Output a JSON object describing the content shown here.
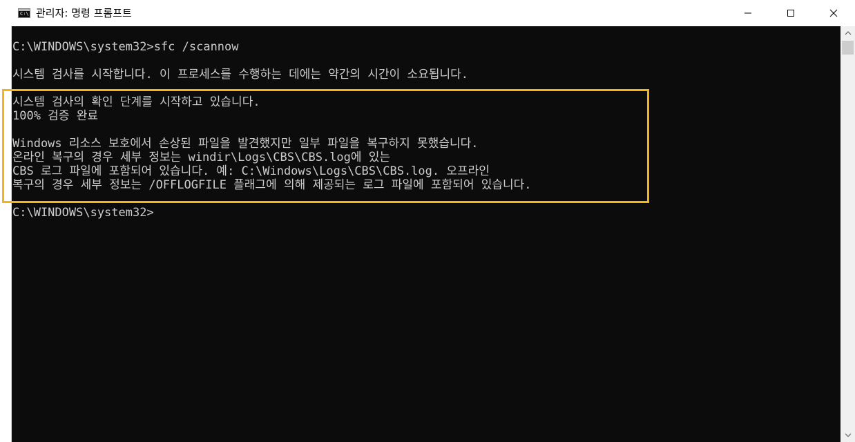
{
  "window": {
    "title": "관리자: 명령 프롬프트",
    "icon": "command-prompt-icon",
    "icon_glyph": "C:\\"
  },
  "controls": {
    "minimize_icon": "minimize-icon",
    "maximize_icon": "maximize-icon",
    "close_icon": "close-icon"
  },
  "console": {
    "lines": [
      "C:\\WINDOWS\\system32>sfc /scannow",
      "",
      "시스템 검사를 시작합니다. 이 프로세스를 수행하는 데에는 약간의 시간이 소요됩니다.",
      "",
      "시스템 검사의 확인 단계를 시작하고 있습니다.",
      "100% 검증 완료",
      "",
      "Windows 리소스 보호에서 손상된 파일을 발견했지만 일부 파일을 복구하지 못했습니다.",
      "온라인 복구의 경우 세부 정보는 windir\\Logs\\CBS\\CBS.log에 있는",
      "CBS 로그 파일에 포함되어 있습니다. 예: C:\\Windows\\Logs\\CBS\\CBS.log. 오프라인",
      "복구의 경우 세부 정보는 /OFFLOGFILE 플래그에 의해 제공되는 로그 파일에 포함되어 있습니다.",
      "C:\\WINDOWS\\system32>"
    ],
    "highlight_color": "#f5b21a",
    "text_color": "#cccccc",
    "background_color": "#0c0c0c"
  }
}
